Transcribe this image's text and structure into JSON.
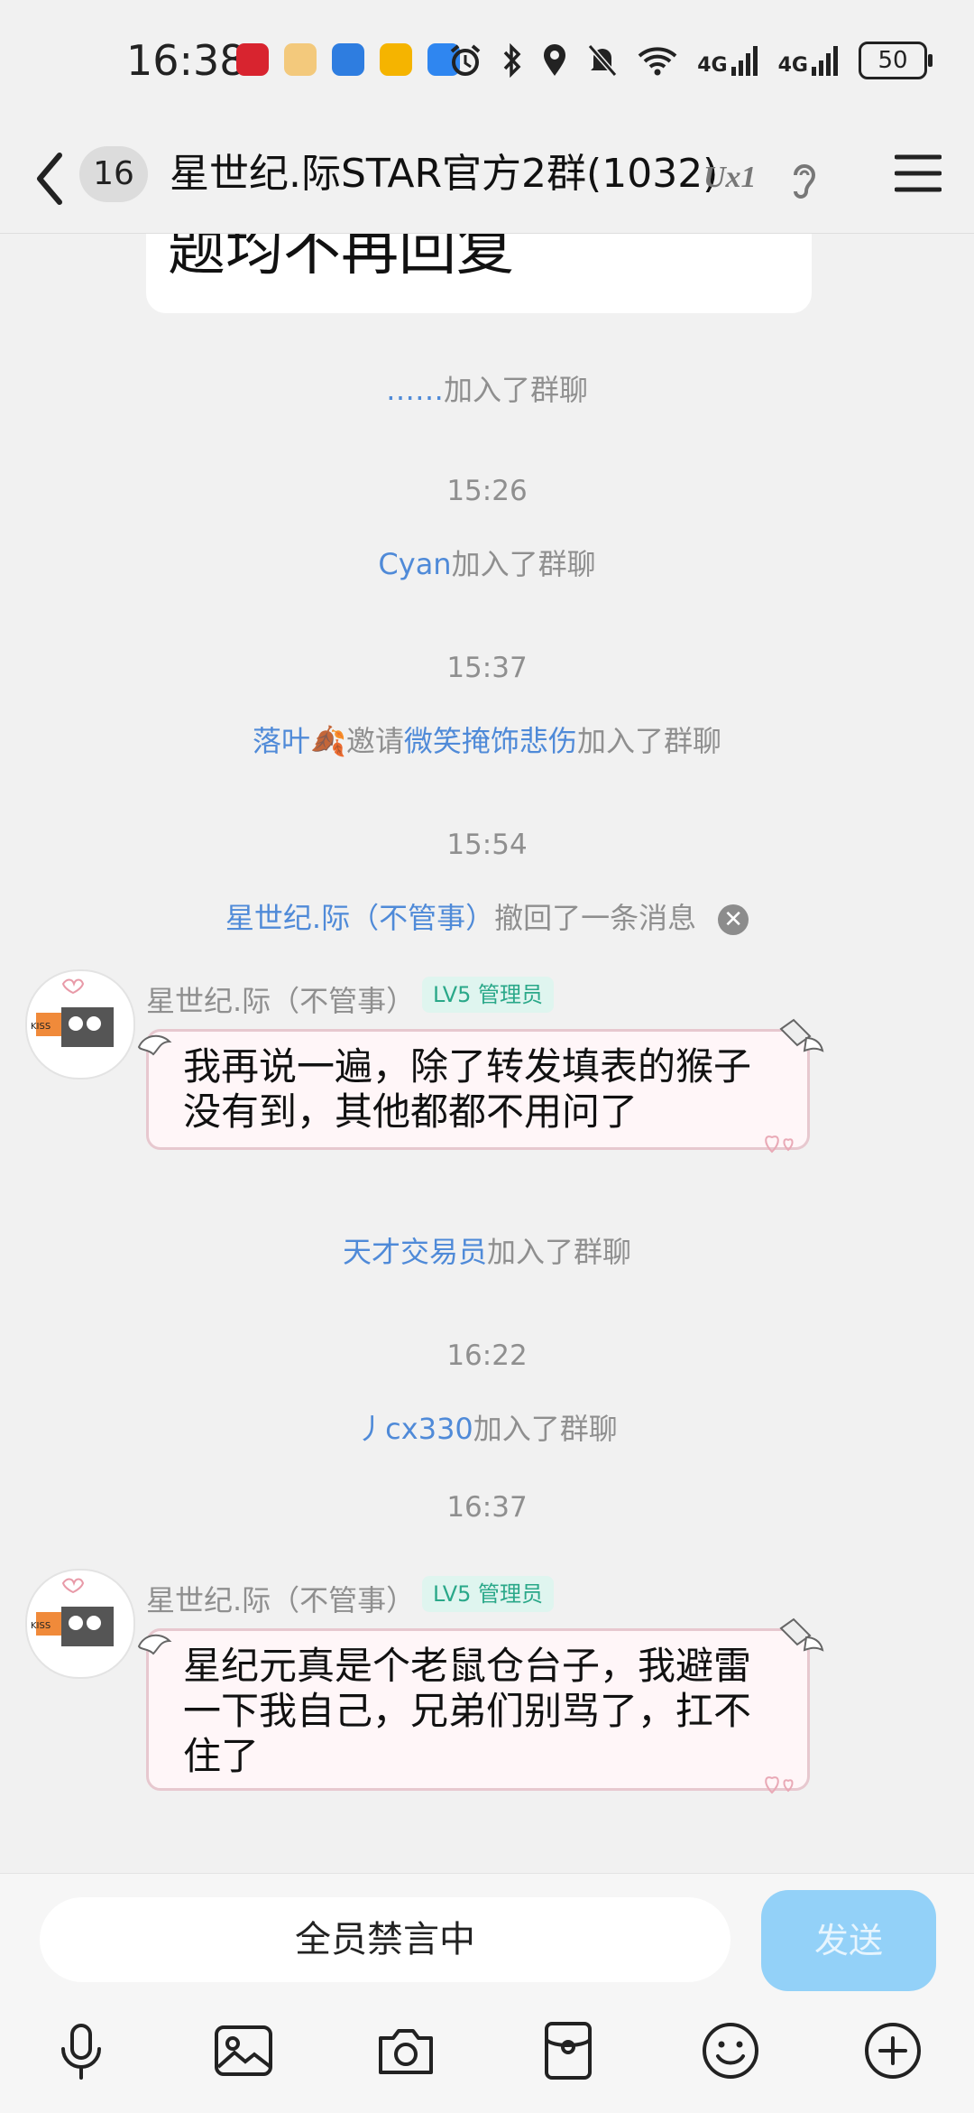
{
  "status": {
    "time": "16:38",
    "network_1": "4G",
    "network_2": "4G",
    "battery": "50"
  },
  "header": {
    "unread_count": "16",
    "title": "星世纪.际STAR官方2群(1032)",
    "badge_text": "Ux1"
  },
  "chat": {
    "notice_fragment": "题均不再回复",
    "events": [
      {
        "name": "……",
        "text": "加入了群聊"
      },
      {
        "time": "15:26"
      },
      {
        "name": "Cyan",
        "text": "加入了群聊"
      },
      {
        "time": "15:37"
      },
      {
        "name": "落叶🍂",
        "mid": "邀请",
        "name2": "微笑掩饰悲伤",
        "text": "加入了群聊"
      },
      {
        "time": "15:54"
      },
      {
        "name": "星世纪.际（不管事）",
        "text": "撤回了一条消息"
      }
    ],
    "message_1": {
      "sender": "星世纪.际（不管事）",
      "level": "LV5 管理员",
      "text": "我再说一遍，除了转发填表的猴子没有到，其他都都不用问了"
    },
    "join_2": {
      "name": "天才交易员",
      "text": "加入了群聊"
    },
    "time_4": "16:22",
    "join_3": {
      "name": "丿cx330",
      "text": "加入了群聊"
    },
    "time_5": "16:37",
    "message_2": {
      "sender": "星世纪.际（不管事）",
      "level": "LV5 管理员",
      "text": "星纪元真是个老鼠仓台子，我避雷一下我自己，兄弟们别骂了，扛不住了"
    }
  },
  "input": {
    "placeholder": "全员禁言中",
    "send_label": "发送"
  },
  "toolbar": [
    "mic-icon",
    "image-icon",
    "camera-icon",
    "red-packet-icon",
    "emoji-icon",
    "plus-icon"
  ],
  "colors": {
    "name_link": "#4f8ad8",
    "send_button": "#93d1f8",
    "admin_badge": "#2aa889"
  }
}
